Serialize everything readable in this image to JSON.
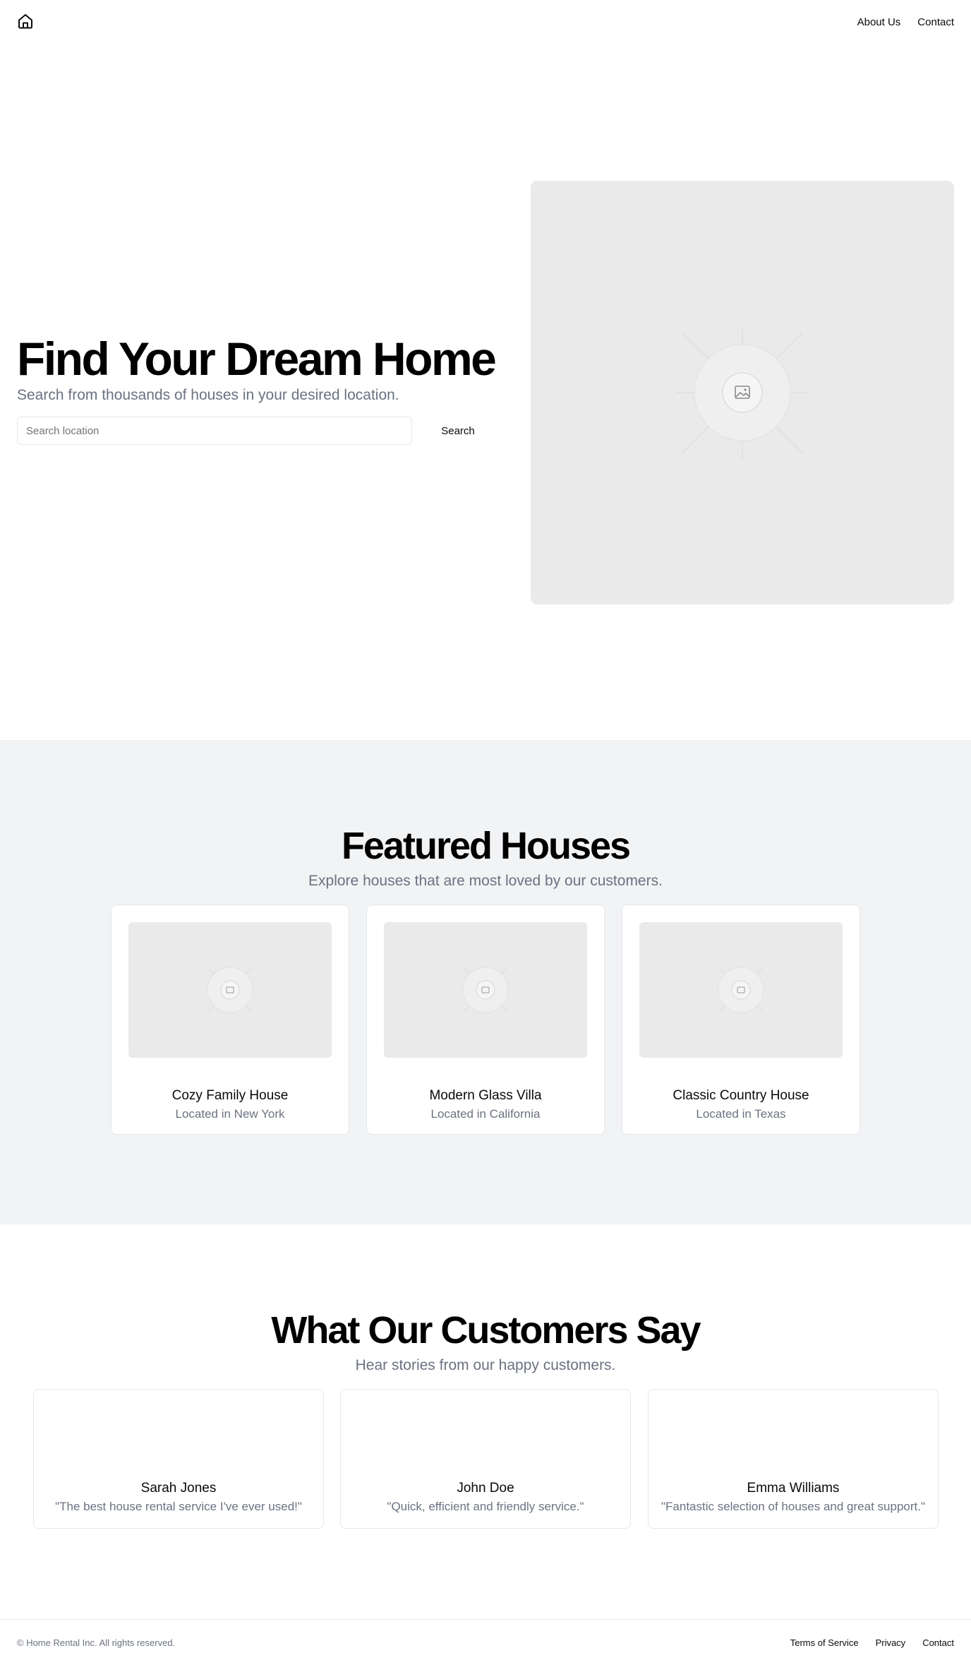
{
  "header": {
    "logo_icon": "home-icon",
    "nav": [
      {
        "label": "About Us"
      },
      {
        "label": "Contact"
      }
    ]
  },
  "hero": {
    "title": "Find Your Dream Home",
    "subtitle": "Search from thousands of houses in your desired location.",
    "search_placeholder": "Search location",
    "search_value": "",
    "search_button": "Search",
    "image_icon": "image-placeholder-icon"
  },
  "featured": {
    "title": "Featured Houses",
    "subtitle": "Explore houses that are most loved by our customers.",
    "houses": [
      {
        "name": "Cozy Family House",
        "location": "Located in New York"
      },
      {
        "name": "Modern Glass Villa",
        "location": "Located in California"
      },
      {
        "name": "Classic Country House",
        "location": "Located in Texas"
      }
    ]
  },
  "testimonials": {
    "title": "What Our Customers Say",
    "subtitle": "Hear stories from our happy customers.",
    "items": [
      {
        "name": "Sarah Jones",
        "quote": "\"The best house rental service I've ever used!\""
      },
      {
        "name": "John Doe",
        "quote": "\"Quick, efficient and friendly service.\""
      },
      {
        "name": "Emma Williams",
        "quote": "\"Fantastic selection of houses and great support.\""
      }
    ]
  },
  "footer": {
    "copyright": "© Home Rental Inc. All rights reserved.",
    "links": [
      {
        "label": "Terms of Service"
      },
      {
        "label": "Privacy"
      },
      {
        "label": "Contact"
      }
    ]
  },
  "colors": {
    "background": "#ffffff",
    "section_alt": "#f2f3f5",
    "placeholder": "#eaeaea",
    "muted_text": "#6b7280",
    "border": "#e5e7eb"
  }
}
